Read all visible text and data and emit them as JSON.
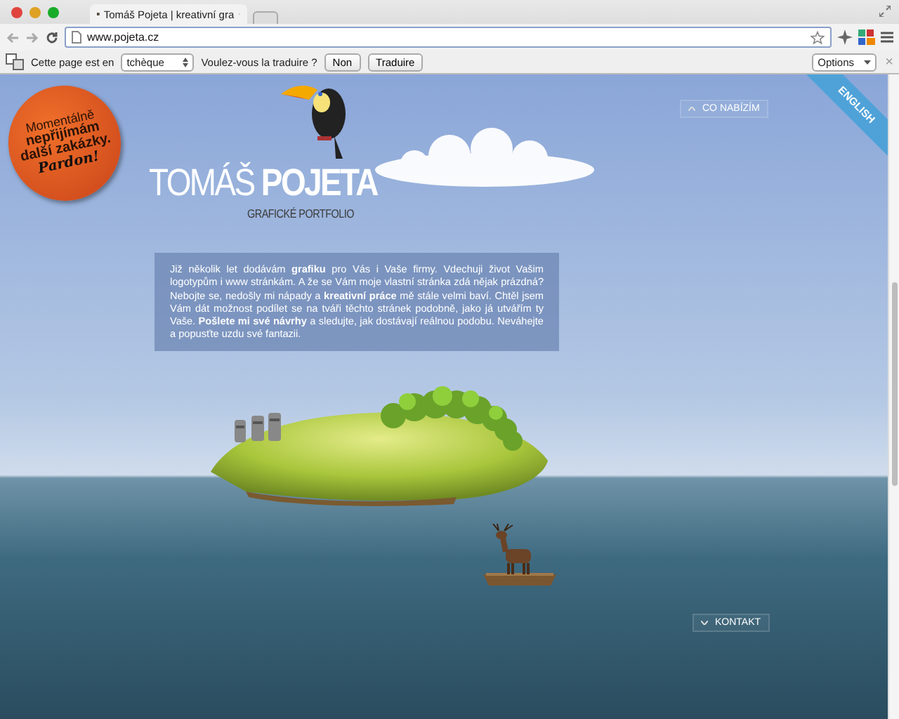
{
  "tabs": [
    {
      "title": "Tomáš Pojeta | kreativní gra",
      "selected": true
    }
  ],
  "address_bar": {
    "value": "www.pojeta.cz"
  },
  "translate_bar": {
    "prefix": "Cette page est en",
    "language": "tchèque",
    "question": "Voulez-vous la traduire ?",
    "buttons": [
      "Non",
      "Traduire"
    ],
    "options": "Options",
    "close": "×"
  },
  "sticker": {
    "lines": [
      "Momentálně",
      "nepřijímám",
      "další zakázky.",
      "Pardon!"
    ]
  },
  "logo": {
    "first": "TOMÁŠ",
    "last": "POJETA",
    "subtitle": "GRAFICKÉ PORTFOLIO"
  },
  "intro": "Již několik let dodávám **grafiku** pro Vás i Vaše firmy. Vdechuji život Vašim logotypům i www stránkám. A že se Vám moje vlastní stránka zdá nějak prázdná? Nebojte se, nedošly mi nápady a **kreativní práce** mě stále velmi baví. Chtěl jsem Vám dát možnost podílet se na tváři těchto stránek podobně, jako já utvářím ty Vaše. **Pošlete mi své návrhy** a sledujte, jak dostávají reálnou podobu. Neváhejte a popusťte uzdu své fantazii.",
  "nav": [
    {
      "label": "CO NABÍZÍM",
      "kind": "up"
    },
    {
      "label": "KONTAKT",
      "kind": "down"
    }
  ],
  "language_ribbon": "ENGLISH"
}
